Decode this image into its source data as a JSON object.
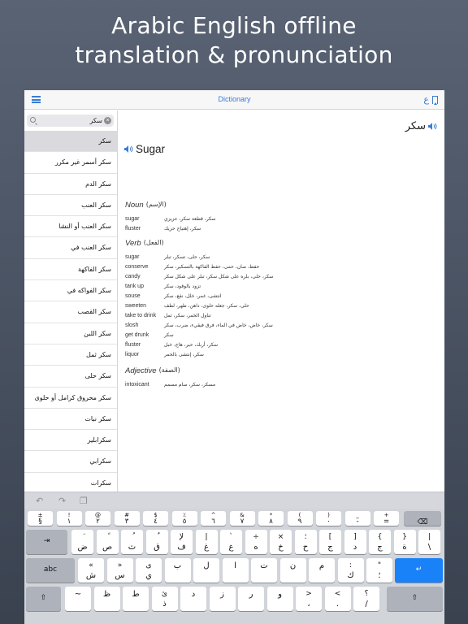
{
  "banner": {
    "line1": "Arabic English offline",
    "line2": "translation & pronunciation"
  },
  "navbar": {
    "title": "Dictionary",
    "lang_glyph": "ع"
  },
  "search": {
    "value": "سكر"
  },
  "wordlist": [
    "سكر",
    "سكر أسمر غير مكرر",
    "سكر الدم",
    "سكر العنب",
    "سكر العنب أو النشا",
    "سكر العنب في",
    "سكر الفاكهة",
    "سكر الفواكه في",
    "سكر القصب",
    "سكر اللبن",
    "سكر ثمل",
    "سكر حلى",
    "سكر محروق كرامل أو حلوى",
    "سكر نبات",
    "سكرابلير",
    "سكرابي",
    "سكرات"
  ],
  "entry": {
    "arabic": "سكر",
    "english": "Sugar",
    "sections": [
      {
        "pos": "Noun",
        "pos_ar": "(الإسم)",
        "rows": [
          {
            "en": "sugar",
            "ar": "سكر، قطعة سكر، عزيزي"
          },
          {
            "en": "fluster",
            "ar": "سكر، إهتياج حزيك"
          }
        ]
      },
      {
        "pos": "Verb",
        "pos_ar": "(الفعل)",
        "rows": [
          {
            "en": "sugar",
            "ar": "سكر، حلى، تسكر، تبلر"
          },
          {
            "en": "conserve",
            "ar": "حفظ، صان، حمى، حفظ الفاكهة بالتسكير، سكر"
          },
          {
            "en": "candy",
            "ar": "سكر، حلى، بلره على شكل سكر، تبلر على شكل سكر"
          },
          {
            "en": "tank up",
            "ar": "تزود بالوقود، سكر"
          },
          {
            "en": "souse",
            "ar": "انتشى، غمر، خلل، نقع، سكر"
          },
          {
            "en": "sweeten",
            "ar": "حلى، سكر، جعله حلوى، داهن، طهر، لطف"
          },
          {
            "en": "take to drink",
            "ar": "تناول الخمر، سكر، ثمل"
          },
          {
            "en": "slosh",
            "ar": "سكر، خاض، خاض في الماء، فرق فيقيء، ضرب، سكر"
          },
          {
            "en": "get drunk",
            "ar": "سكر"
          },
          {
            "en": "fluster",
            "ar": "سكر، أربك، حير، هاج، خبل"
          },
          {
            "en": "liquor",
            "ar": "سكر، إنتشى بالخمر"
          }
        ]
      },
      {
        "pos": "Adjective",
        "pos_ar": "(الصفة)",
        "rows": [
          {
            "en": "intoxicant",
            "ar": "مسكر، سكر، سام مسمم"
          }
        ]
      }
    ]
  },
  "toolbar": {
    "undo": "↶",
    "redo": "↷",
    "paste": "❐"
  },
  "keyboard": {
    "row1": [
      {
        "s": "±",
        "m": "§"
      },
      {
        "s": "!",
        "m": "١"
      },
      {
        "s": "@",
        "m": "٢"
      },
      {
        "s": "#",
        "m": "٣"
      },
      {
        "s": "$",
        "m": "٤"
      },
      {
        "s": "٪",
        "m": "٥"
      },
      {
        "s": "^",
        "m": "٦"
      },
      {
        "s": "&",
        "m": "٧"
      },
      {
        "s": "*",
        "m": "٨"
      },
      {
        "s": "(",
        "m": "٩"
      },
      {
        "s": ")",
        "m": "٠"
      },
      {
        "s": "_",
        "m": "-"
      },
      {
        "s": "+",
        "m": "="
      }
    ],
    "row2": [
      {
        "s": "َ",
        "m": "ض"
      },
      {
        "s": "ً",
        "m": "ص"
      },
      {
        "s": "ُ",
        "m": "ث"
      },
      {
        "s": "ٌ",
        "m": "ق"
      },
      {
        "s": "ﻹ",
        "m": "ف"
      },
      {
        "s": "إ",
        "m": "غ"
      },
      {
        "s": "`",
        "m": "ع"
      },
      {
        "s": "÷",
        "m": "ه"
      },
      {
        "s": "×",
        "m": "خ"
      },
      {
        "s": "؛",
        "m": "ح"
      },
      {
        "s": "[",
        "m": "ج"
      },
      {
        "s": "]",
        "m": "د"
      },
      {
        "s": "{",
        "m": "ج"
      },
      {
        "s": "}",
        "m": "ة"
      },
      {
        "s": "|",
        "m": "\\"
      }
    ],
    "row3": [
      {
        "s": "«",
        "m": "ش"
      },
      {
        "s": "»",
        "m": "س"
      },
      {
        "s": "ى",
        "m": "ي"
      },
      {
        "s": "",
        "m": "ب"
      },
      {
        "s": "",
        "m": "ل"
      },
      {
        "s": "",
        "m": "ا"
      },
      {
        "s": "",
        "m": "ت"
      },
      {
        "s": "",
        "m": "ن"
      },
      {
        "s": "",
        "m": "م"
      },
      {
        "s": ":",
        "m": "ك"
      },
      {
        "s": "\"",
        "m": "؛"
      }
    ],
    "row4": [
      {
        "s": "",
        "m": "~"
      },
      {
        "s": "",
        "m": "ظ"
      },
      {
        "s": "",
        "m": "ط"
      },
      {
        "s": "ئ",
        "m": "ذ"
      },
      {
        "s": "",
        "m": "د"
      },
      {
        "s": "",
        "m": "ز"
      },
      {
        "s": "",
        "m": "ر"
      },
      {
        "s": "",
        "m": "و"
      },
      {
        "s": ">",
        "m": "،"
      },
      {
        "s": "<",
        "m": "."
      },
      {
        "s": "؟",
        "m": "/"
      }
    ],
    "tab_label": "⇥",
    "caps_label": "abc",
    "shift_label": "⇧",
    "delete_label": "⌫",
    "return_label": "↵"
  },
  "colors": {
    "accent": "#3a7bd5",
    "return_key": "#1a82f8",
    "background": "#4b5463"
  }
}
